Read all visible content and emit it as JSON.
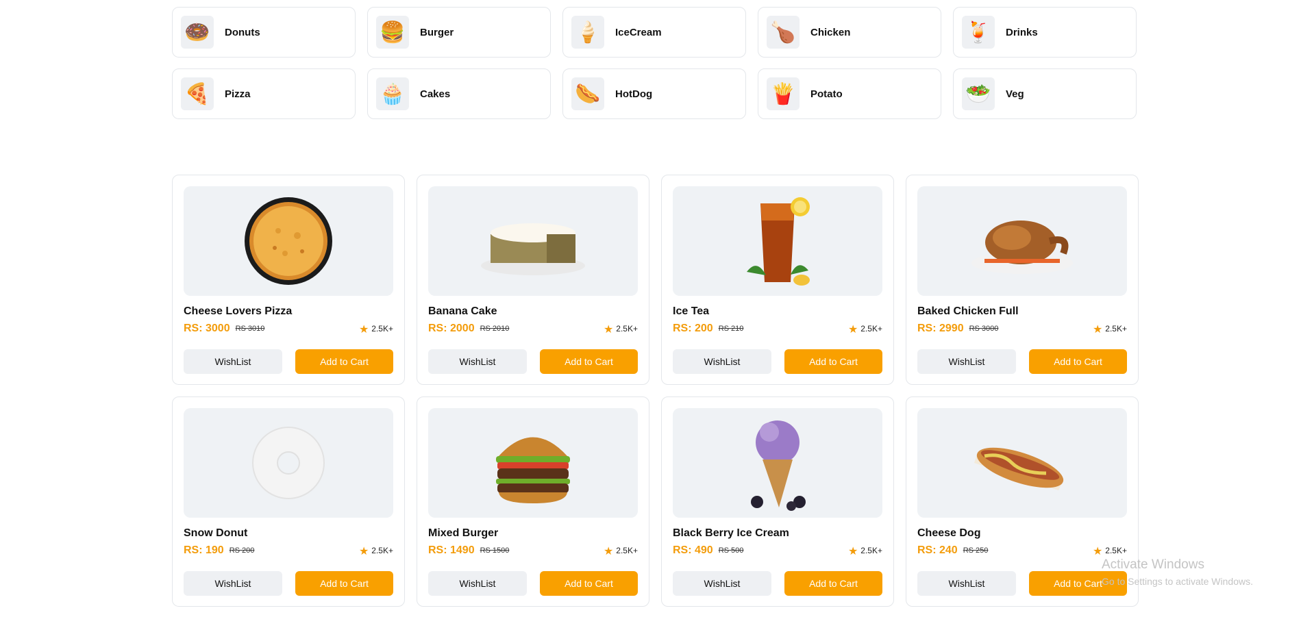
{
  "categories": [
    {
      "label": "Donuts",
      "icon": "donut-icon",
      "glyph": "🍩"
    },
    {
      "label": "Burger",
      "icon": "burger-icon",
      "glyph": "🍔"
    },
    {
      "label": "IceCream",
      "icon": "ice-cream-icon",
      "glyph": "🍦"
    },
    {
      "label": "Chicken",
      "icon": "chicken-icon",
      "glyph": "🍗"
    },
    {
      "label": "Drinks",
      "icon": "drinks-icon",
      "glyph": "🍹"
    },
    {
      "label": "Pizza",
      "icon": "pizza-icon",
      "glyph": "🍕"
    },
    {
      "label": "Cakes",
      "icon": "cupcake-icon",
      "glyph": "🧁"
    },
    {
      "label": "HotDog",
      "icon": "hotdog-icon",
      "glyph": "🌭"
    },
    {
      "label": "Potato",
      "icon": "fries-icon",
      "glyph": "🍟"
    },
    {
      "label": "Veg",
      "icon": "salad-icon",
      "glyph": "🥗"
    }
  ],
  "products": [
    {
      "name": "Cheese Lovers Pizza",
      "price": "RS: 3000",
      "old_price": "RS 3010",
      "rating": "2.5K+",
      "image": "pizza-image"
    },
    {
      "name": "Banana Cake",
      "price": "RS: 2000",
      "old_price": "RS 2010",
      "rating": "2.5K+",
      "image": "cake-image"
    },
    {
      "name": "Ice Tea",
      "price": "RS: 200",
      "old_price": "RS 210",
      "rating": "2.5K+",
      "image": "ice-tea-image"
    },
    {
      "name": "Baked Chicken Full",
      "price": "RS: 2990",
      "old_price": "RS 3000",
      "rating": "2.5K+",
      "image": "roast-chicken-image"
    },
    {
      "name": "Snow Donut",
      "price": "RS: 190",
      "old_price": "RS 200",
      "rating": "2.5K+",
      "image": "donut-image"
    },
    {
      "name": "Mixed Burger",
      "price": "RS: 1490",
      "old_price": "RS 1500",
      "rating": "2.5K+",
      "image": "burger-image"
    },
    {
      "name": "Black Berry Ice Cream",
      "price": "RS: 490",
      "old_price": "RS 500",
      "rating": "2.5K+",
      "image": "ice-cream-image"
    },
    {
      "name": "Cheese Dog",
      "price": "RS: 240",
      "old_price": "RS 250",
      "rating": "2.5K+",
      "image": "hotdog-image"
    }
  ],
  "buttons": {
    "wishlist": "WishList",
    "add_to_cart": "Add to Cart"
  },
  "colors": {
    "accent": "#f9a000",
    "price": "#f39c0b",
    "image_bg": "#eff2f5",
    "border": "#e3e6ea"
  },
  "watermark": {
    "title": "Activate Windows",
    "subtitle": "Go to Settings to activate Windows."
  }
}
